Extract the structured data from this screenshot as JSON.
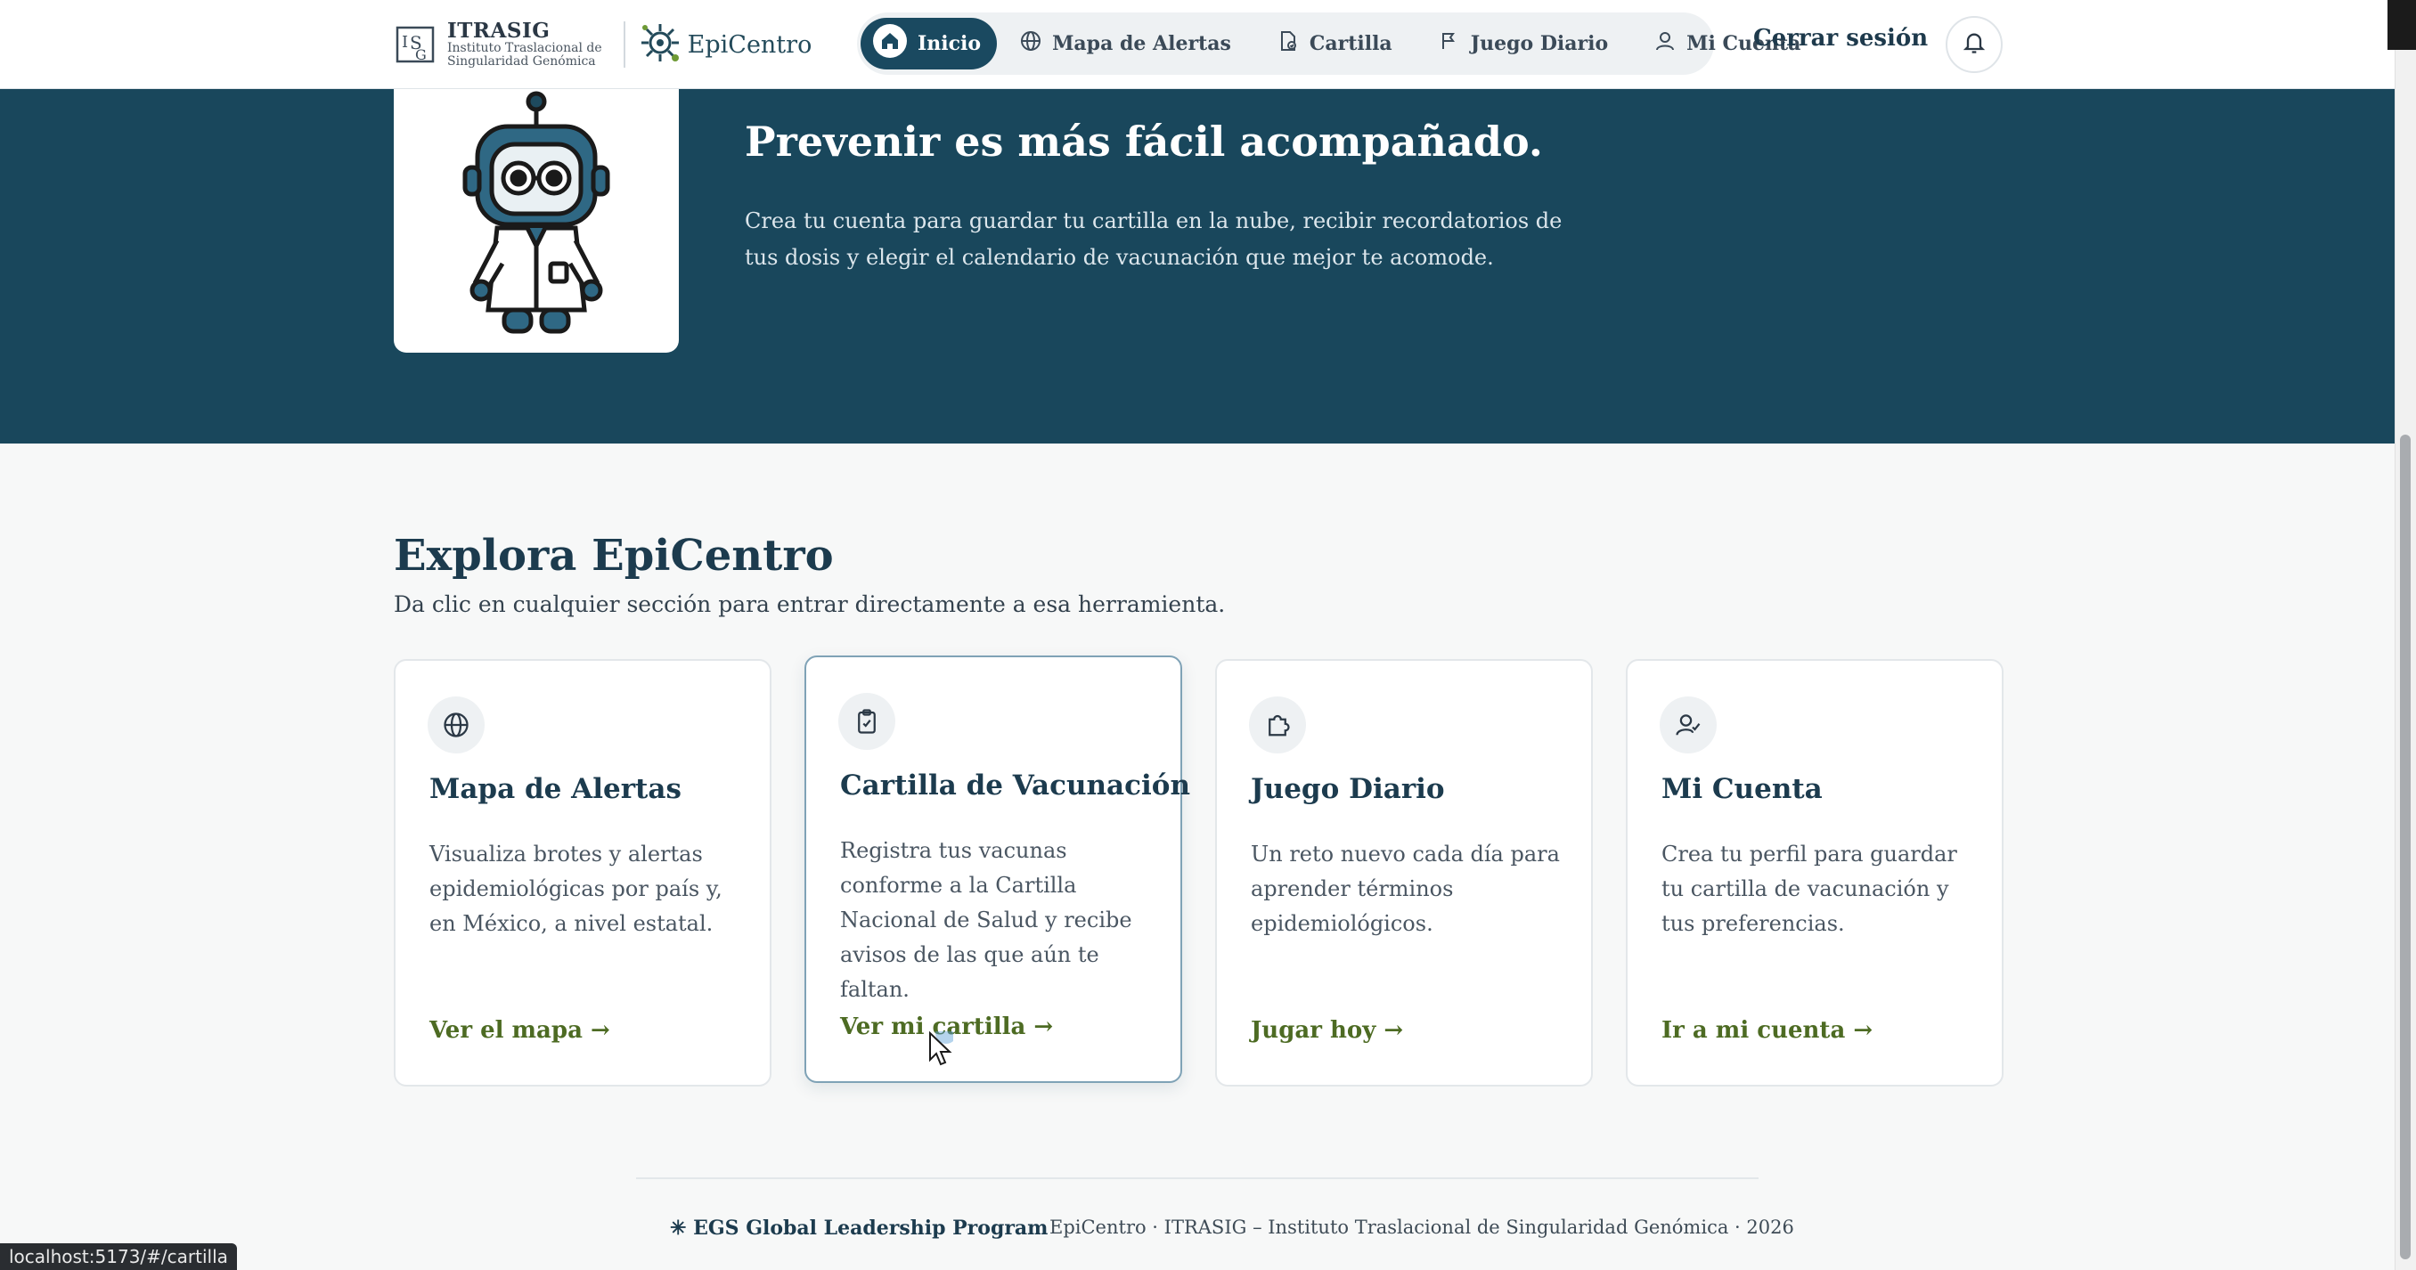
{
  "header": {
    "brand_title": "ITRASIG",
    "brand_sub_1": "Instituto Traslacional de",
    "brand_sub_2": "Singularidad Genómica",
    "app_name": "EpiCentro",
    "nav": [
      {
        "label": "Inicio",
        "icon": "home-icon",
        "active": true
      },
      {
        "label": "Mapa de Alertas",
        "icon": "globe-icon"
      },
      {
        "label": "Cartilla",
        "icon": "document-icon"
      },
      {
        "label": "Juego Diario",
        "icon": "puzzle-icon"
      },
      {
        "label": "Mi Cuenta",
        "icon": "user-icon"
      }
    ],
    "logout_label": "Cerrar sesión",
    "notifications_icon": "bell-icon"
  },
  "hero": {
    "title": "Prevenir es más fácil acompañado.",
    "text": "Crea tu cuenta para guardar tu cartilla en la nube, recibir recordatorios de tus dosis y elegir el calendario de vacunación que mejor te acomode."
  },
  "explore": {
    "title": "Explora EpiCentro",
    "subtitle": "Da clic en cualquier sección para entrar directamente a esa herramienta.",
    "cards": [
      {
        "title": "Mapa de Alertas",
        "description": "Visualiza brotes y alertas epidemiológicas por país y, en México, a nivel estatal.",
        "link": "Ver el mapa →",
        "icon": "globe-icon"
      },
      {
        "title": "Cartilla de Vacunación",
        "description": "Registra tus vacunas conforme a la Cartilla Nacional de Salud y recibe avisos de las que aún te faltan.",
        "link": "Ver mi cartilla →",
        "icon": "clipboard-check-icon"
      },
      {
        "title": "Juego Diario",
        "description": "Un reto nuevo cada día para aprender términos epidemiológicos.",
        "link": "Jugar hoy →",
        "icon": "puzzle-icon"
      },
      {
        "title": "Mi Cuenta",
        "description": "Crea tu perfil para guardar tu cartilla de vacunación y tus preferencias.",
        "link": "Ir a mi cuenta →",
        "icon": "user-check-icon"
      }
    ]
  },
  "footer": {
    "program": "✳ EGS Global Leadership Program",
    "credits": "EpiCentro · ITRASIG – Instituto Traslacional de Singularidad Genómica · 2026"
  },
  "status_bar": {
    "url": "localhost:5173/#/cartilla"
  },
  "colors": {
    "primary": "#19475c",
    "accent_link": "#4d6b23",
    "background": "#f7f8f8"
  }
}
